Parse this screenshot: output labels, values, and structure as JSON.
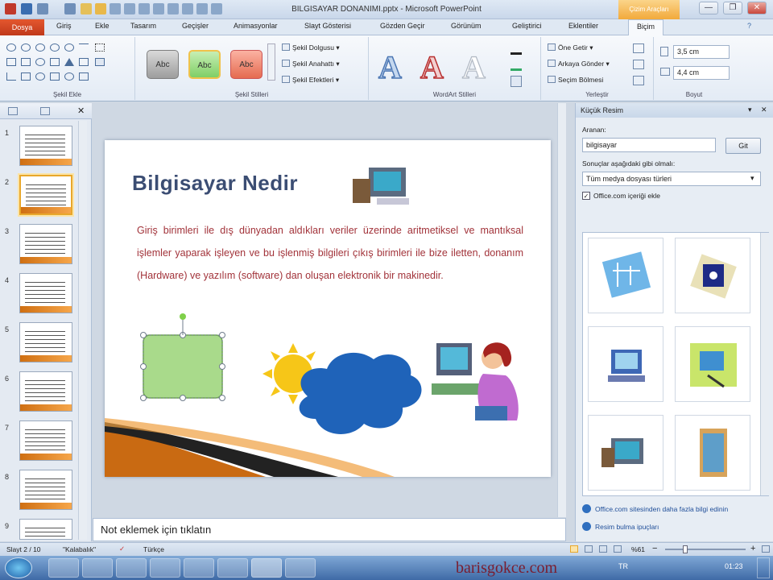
{
  "window": {
    "title": "BILGISAYAR DONANIMI.pptx - Microsoft PowerPoint",
    "context_tab": "Çizim Araçları",
    "min": "—",
    "max": "❐",
    "close": "✕"
  },
  "tabs": [
    "Dosya",
    "Giriş",
    "Ekle",
    "Tasarım",
    "Geçişler",
    "Animasyonlar",
    "Slayt Gösterisi",
    "Gözden Geçir",
    "Görünüm",
    "Geliştirici",
    "Eklentiler",
    "Biçim"
  ],
  "ribbon": {
    "insert_shapes_label": "Şekil Ekle",
    "shape_styles_label": "Şekil Stilleri",
    "style_samples": [
      "Abc",
      "Abc",
      "Abc"
    ],
    "shape_fill": "Şekil Dolgusu",
    "shape_outline": "Şekil Anahattı",
    "shape_effects": "Şekil Efektleri",
    "wordart_label": "WordArt Stilleri",
    "wordart_samples": [
      "A",
      "A",
      "A"
    ],
    "bring_forward": "Öne Getir",
    "send_backward": "Arkaya Gönder",
    "selection_pane": "Seçim Bölmesi",
    "arrange_label": "Yerleştir",
    "height": "3,5 cm",
    "width": "4,4 cm",
    "size_label": "Boyut"
  },
  "slides": [
    "1",
    "2",
    "3",
    "4",
    "5",
    "6",
    "7",
    "8",
    "9"
  ],
  "slide": {
    "title": "Bilgisayar  Nedir",
    "body": "Giriş  birimleri    ile dış  dünyadan  aldıkları  veriler   üzerinde aritmetiksel ve mantıksal  işlemler  yaparak  işleyen  ve bu işlenmiş bilgileri  çıkış birimleri  ile bize iletten, donanım (Hardware) ve  yazılım  (software) dan oluşan elektronik bir makinedir."
  },
  "notes_placeholder": "Not eklemek için tıklatın",
  "taskpane": {
    "title": "Küçük Resim",
    "search_label": "Aranan:",
    "search_value": "bilgisayar",
    "go_button": "Git",
    "results_label": "Sonuçlar aşağıdaki gibi olmalı:",
    "media_type": "Tüm medya dosyası türleri",
    "include_office": "Office.com içeriği ekle",
    "more_link": "Office.com sitesinden daha fazla bilgi edinin",
    "tips_link": "Resim bulma ipuçları"
  },
  "status": {
    "slide_info": "Slayt 2 / 10",
    "theme": "\"Kalabalık\"",
    "language": "Türkçe",
    "zoom": "%61"
  },
  "taskbar": {
    "lang": "TR",
    "clock": "01:23"
  },
  "watermark": "barisgokce.com",
  "colors": {
    "accent": "#e8a72b",
    "file_tab": "#d24726",
    "title_blue": "#3b4d73",
    "body_red": "#a2333a"
  }
}
